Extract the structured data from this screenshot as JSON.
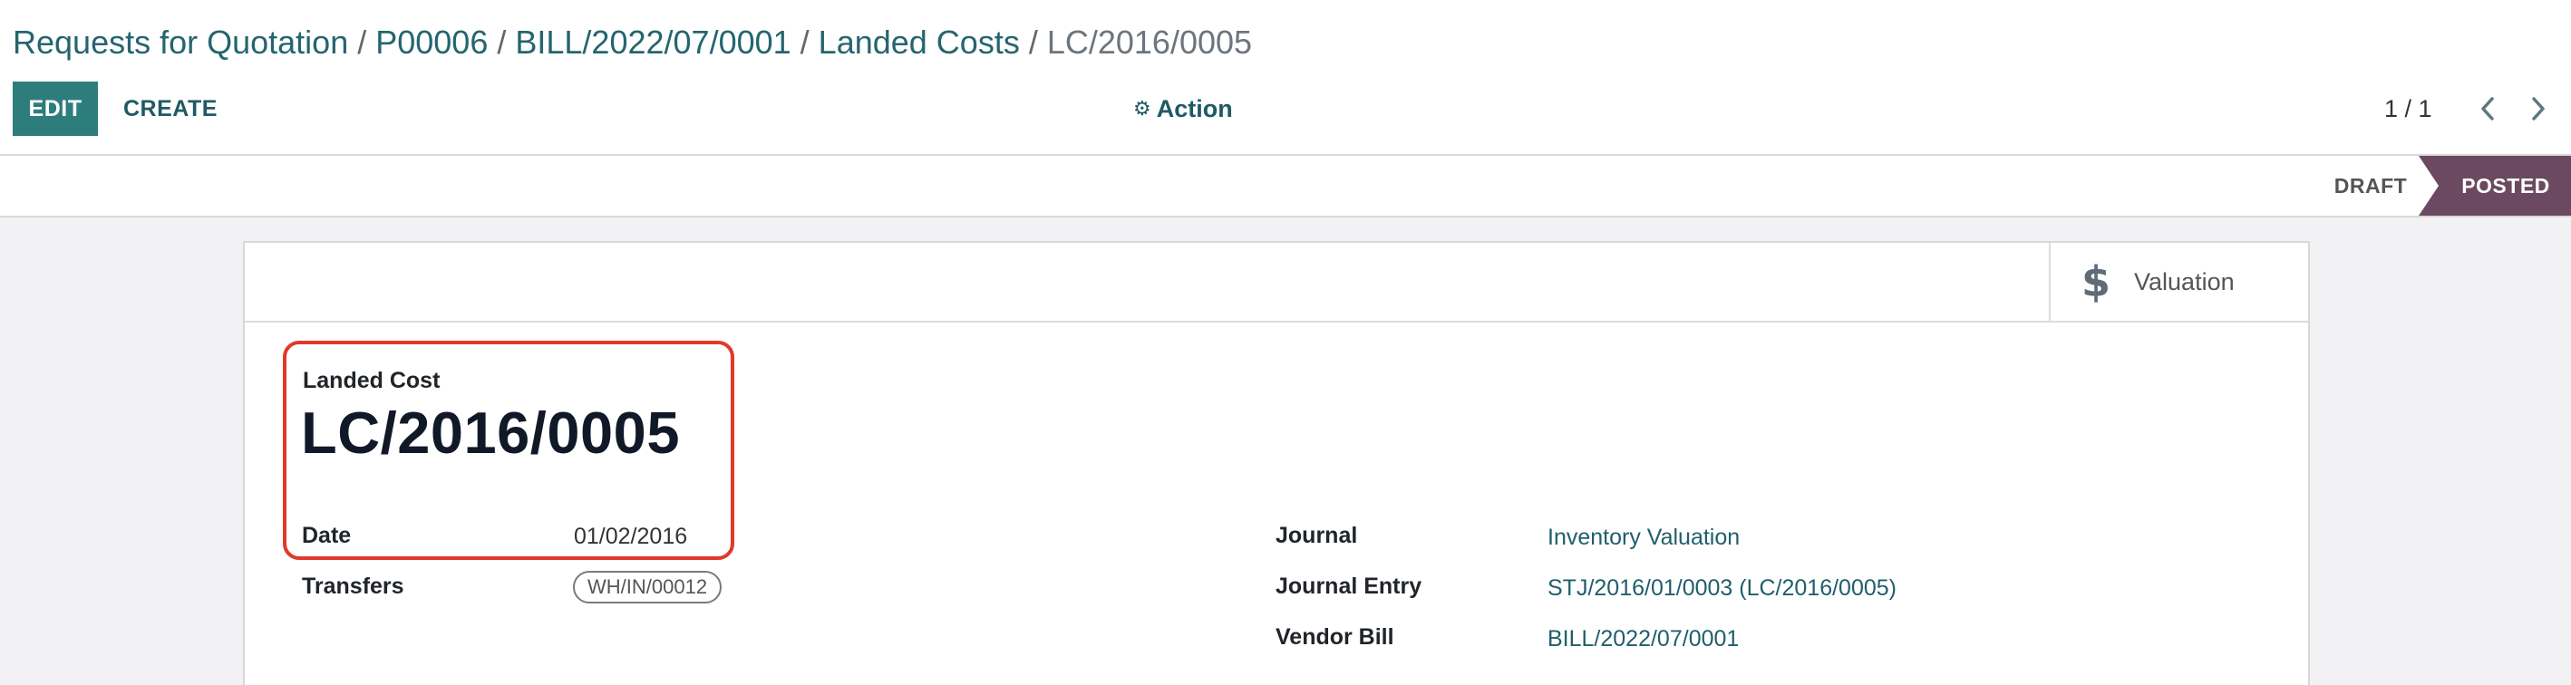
{
  "breadcrumb": {
    "items": [
      {
        "label": "Requests for Quotation"
      },
      {
        "label": "P00006"
      },
      {
        "label": "BILL/2022/07/0001"
      },
      {
        "label": "Landed Costs"
      }
    ],
    "separator": "/",
    "current": "LC/2016/0005"
  },
  "toolbar": {
    "edit_label": "EDIT",
    "create_label": "CREATE",
    "action_label": "Action",
    "action_icon": "gear-icon"
  },
  "pager": {
    "value": "1 / 1"
  },
  "statusbar": {
    "draft_label": "DRAFT",
    "posted_label": "POSTED",
    "active_color": "#6b4960"
  },
  "smart_buttons": {
    "valuation_label": "Valuation",
    "valuation_icon": "dollar-icon"
  },
  "form": {
    "title_label": "Landed Cost",
    "title_value": "LC/2016/0005",
    "date_label": "Date",
    "date_value": "01/02/2016",
    "transfers_label": "Transfers",
    "transfers_tag": "WH/IN/00012",
    "journal_label": "Journal",
    "journal_value": "Inventory Valuation",
    "journal_entry_label": "Journal Entry",
    "journal_entry_value": "STJ/2016/01/0003 (LC/2016/0005)",
    "vendor_bill_label": "Vendor Bill",
    "vendor_bill_value": "BILL/2022/07/0001"
  },
  "colors": {
    "primary": "#2e7d7d",
    "link": "#24656f",
    "highlight": "#e0392b"
  }
}
